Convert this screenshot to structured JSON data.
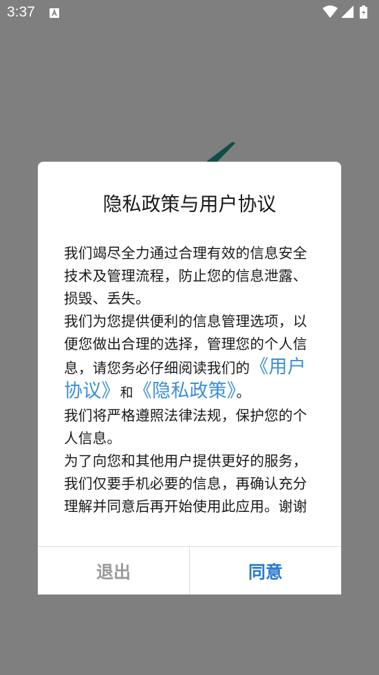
{
  "status_bar": {
    "time": "3:37",
    "notification_icon": "a-letter-icon",
    "right_icons": [
      "wifi-icon",
      "signal-icon",
      "battery-icon"
    ]
  },
  "dialog": {
    "title": "隐私政策与用户协议",
    "paragraph1": "我们竭尽全力通过合理有效的信息安全技术及管理流程，防止您的信息泄露、损毁、丢失。",
    "paragraph2_prefix": "我们为您提供便利的信息管理选项，以便您做出合理的选择，管理您的个人信息，请您务必仔细阅读我们的",
    "user_agreement_link": "《用户协议》",
    "and_text": "和",
    "privacy_policy_link": "《隐私政策》",
    "paragraph2_suffix": "。",
    "paragraph3": "我们将严格遵照法律法规，保护您的个人信息。",
    "paragraph4": "为了向您和其他用户提供更好的服务，我们仅要手机必要的信息，再确认充分理解并同意后再开始使用此应用。谢谢",
    "exit_label": "退出",
    "agree_label": "同意"
  },
  "colors": {
    "link": "#3b8fd6",
    "agree": "#2979d0",
    "exit": "#9a9a9a",
    "overlay": "#7f7f7f"
  }
}
